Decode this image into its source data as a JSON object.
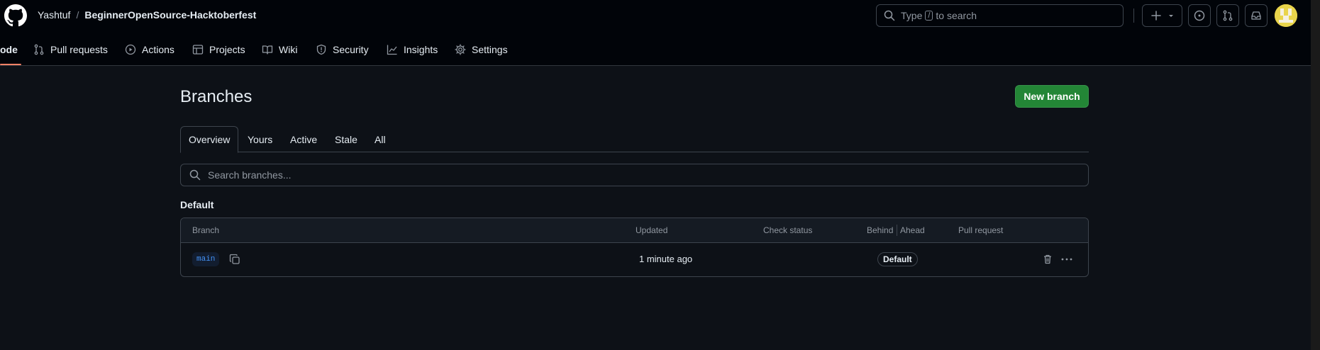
{
  "header": {
    "owner": "Yashtuf",
    "separator": "/",
    "repo": "BeginnerOpenSource-Hacktoberfest",
    "search": {
      "prefix": "Type",
      "key": "/",
      "suffix": "to search"
    }
  },
  "nav": {
    "items": [
      {
        "label": "ode",
        "icon": "code-icon"
      },
      {
        "label": "Pull requests",
        "icon": "git-pull-request-icon"
      },
      {
        "label": "Actions",
        "icon": "play-icon"
      },
      {
        "label": "Projects",
        "icon": "table-icon"
      },
      {
        "label": "Wiki",
        "icon": "book-icon"
      },
      {
        "label": "Security",
        "icon": "shield-icon"
      },
      {
        "label": "Insights",
        "icon": "graph-icon"
      },
      {
        "label": "Settings",
        "icon": "gear-icon"
      }
    ]
  },
  "page": {
    "title": "Branches",
    "new_branch_label": "New branch"
  },
  "tabs": [
    "Overview",
    "Yours",
    "Active",
    "Stale",
    "All"
  ],
  "branch_search": {
    "placeholder": "Search branches..."
  },
  "default_section": {
    "label": "Default",
    "columns": [
      "Branch",
      "Updated",
      "Check status",
      "Behind",
      "Ahead",
      "Pull request"
    ],
    "rows": [
      {
        "branch": "main",
        "updated": "1 minute ago",
        "badge": "Default"
      }
    ]
  },
  "colors": {
    "background": "#0d1117",
    "header": "#010409",
    "accent_green": "#238636",
    "link_blue": "#4493f8",
    "active_underline": "#f78166"
  }
}
